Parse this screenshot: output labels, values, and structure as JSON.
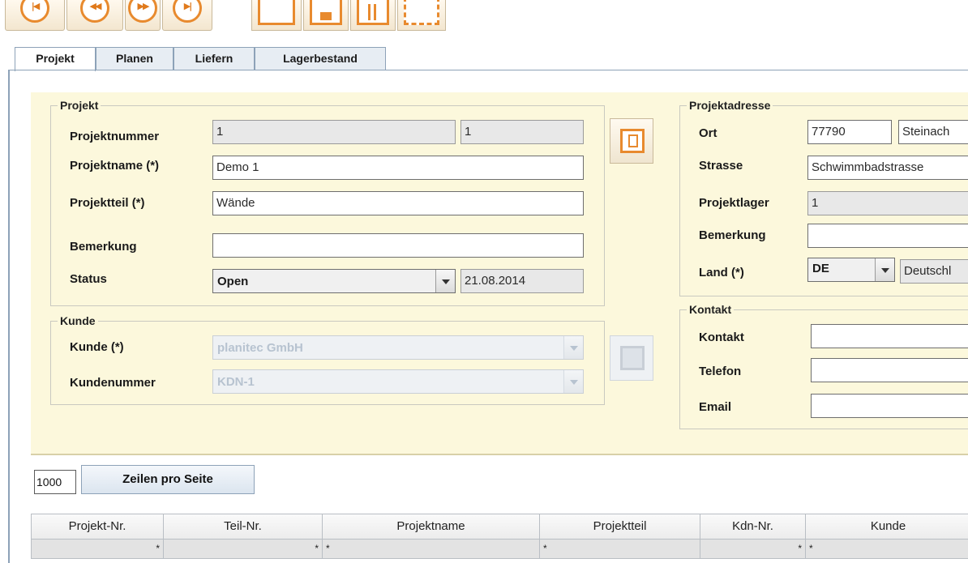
{
  "toolbar": {
    "nav_buttons": [
      {
        "name": "first-record",
        "glyph": "|◀"
      },
      {
        "name": "previous-record",
        "glyph": "◀◀"
      },
      {
        "name": "next-record",
        "glyph": "▶▶"
      },
      {
        "name": "last-record",
        "glyph": "▶|"
      }
    ],
    "action_icons": [
      "new-icon",
      "save-icon",
      "delete-icon",
      "refresh-icon"
    ]
  },
  "tabs": [
    "Projekt",
    "Planen",
    "Liefern",
    "Lagerbestand"
  ],
  "projekt": {
    "legend": "Projekt",
    "projektnummer_label": "Projektnummer",
    "projektnummer_value": "1",
    "projektnummer_value2": "1",
    "projektname_label": "Projektname (*)",
    "projektname_value": "Demo 1",
    "projektteil_label": "Projektteil (*)",
    "projektteil_value": "Wände",
    "bemerkung_label": "Bemerkung",
    "bemerkung_value": "",
    "status_label": "Status",
    "status_value": "Open",
    "status_date": "21.08.2014"
  },
  "kunde": {
    "legend": "Kunde",
    "kunde_label": "Kunde (*)",
    "kunde_value": "planitec GmbH",
    "kundennummer_label": "Kundenummer",
    "kundennummer_value": "KDN-1"
  },
  "projektadresse": {
    "legend": "Projektadresse",
    "ort_label": "Ort",
    "plz_value": "77790",
    "ort_value": "Steinach",
    "strasse_label": "Strasse",
    "strasse_value": "Schwimmbadstrasse",
    "projektlager_label": "Projektlager",
    "projektlager_value": "1",
    "bemerkung_label": "Bemerkung",
    "bemerkung_value": "",
    "land_label": "Land (*)",
    "land_code": "DE",
    "land_name": "Deutschl"
  },
  "kontakt": {
    "legend": "Kontakt",
    "kontakt_label": "Kontakt",
    "kontakt_value": "",
    "telefon_label": "Telefon",
    "telefon_value": "",
    "email_label": "Email",
    "email_value": ""
  },
  "pager": {
    "rows_value": "1000",
    "button_label": "Zeilen pro Seite"
  },
  "table": {
    "columns": [
      "Projekt-Nr.",
      "Teil-Nr.",
      "Projektname",
      "Projektteil",
      "Kdn-Nr.",
      "Kunde"
    ],
    "filters": [
      "*",
      "*",
      "*",
      "*",
      "*",
      "*"
    ]
  },
  "colors": {
    "accent": "#e88a2e",
    "panel_background": "#fcf8dc",
    "tab_border": "#8da2b8"
  }
}
